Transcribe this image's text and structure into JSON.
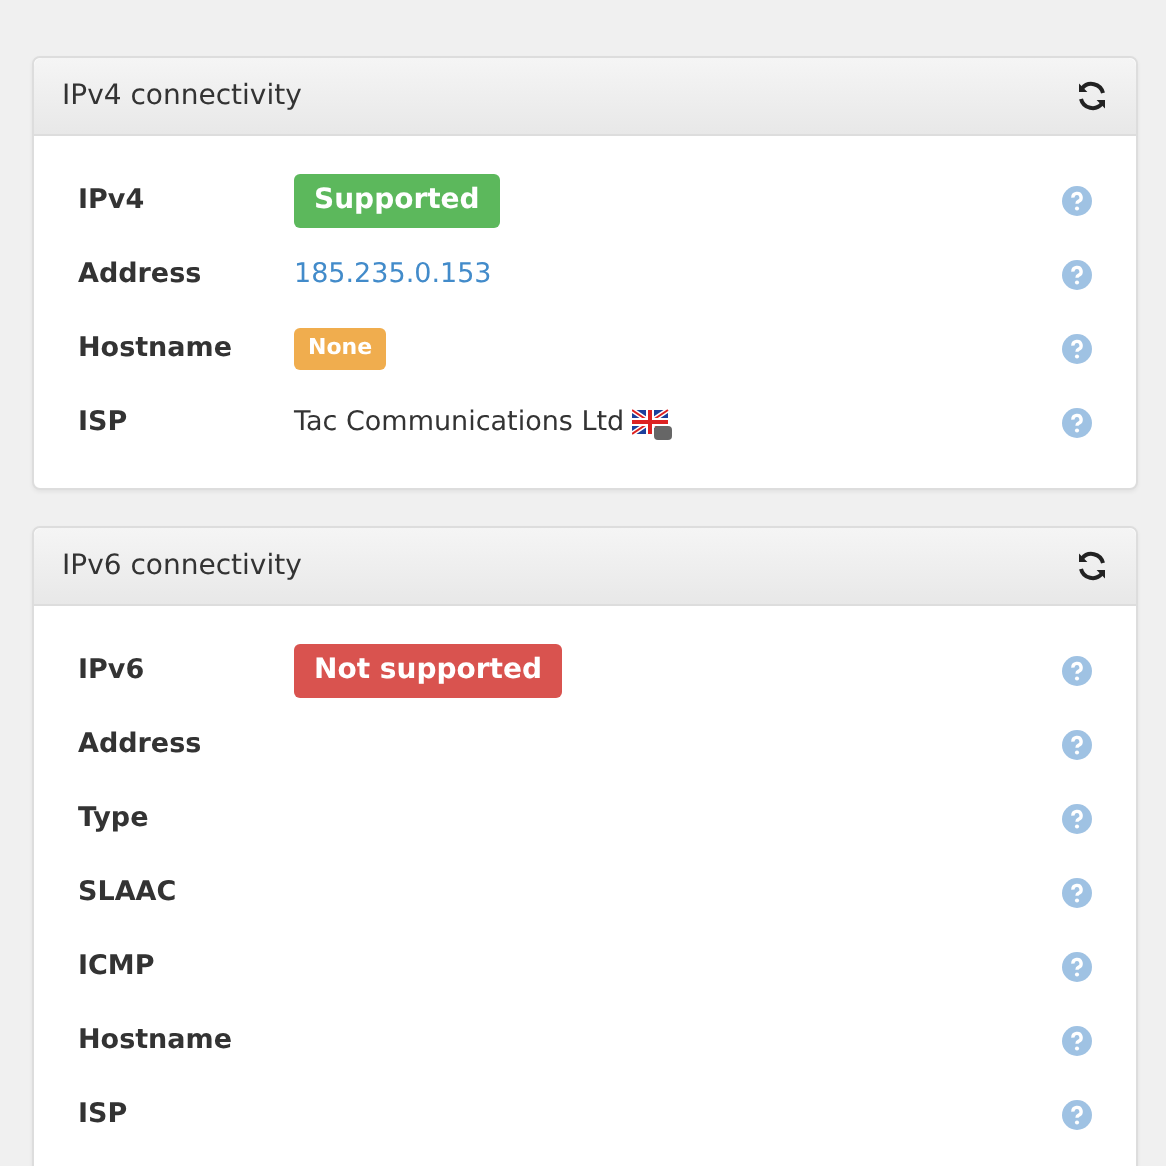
{
  "panels": [
    {
      "title": "IPv4 connectivity",
      "rows": [
        {
          "label": "IPv4",
          "value": {
            "kind": "badge",
            "text": "Supported",
            "color": "#5cb85c"
          }
        },
        {
          "label": "Address",
          "value": {
            "kind": "link",
            "text": "185.235.0.153"
          }
        },
        {
          "label": "Hostname",
          "value": {
            "kind": "small-badge",
            "text": "None",
            "color": "#f0ad4e"
          }
        },
        {
          "label": "ISP",
          "value": {
            "kind": "flag-text",
            "text": "Tac Communications Ltd"
          }
        }
      ]
    },
    {
      "title": "IPv6 connectivity",
      "rows": [
        {
          "label": "IPv6",
          "value": {
            "kind": "badge",
            "text": "Not supported",
            "color": "#d9534f"
          }
        },
        {
          "label": "Address"
        },
        {
          "label": "Type"
        },
        {
          "label": "SLAAC"
        },
        {
          "label": "ICMP"
        },
        {
          "label": "Hostname"
        },
        {
          "label": "ISP"
        }
      ]
    }
  ]
}
